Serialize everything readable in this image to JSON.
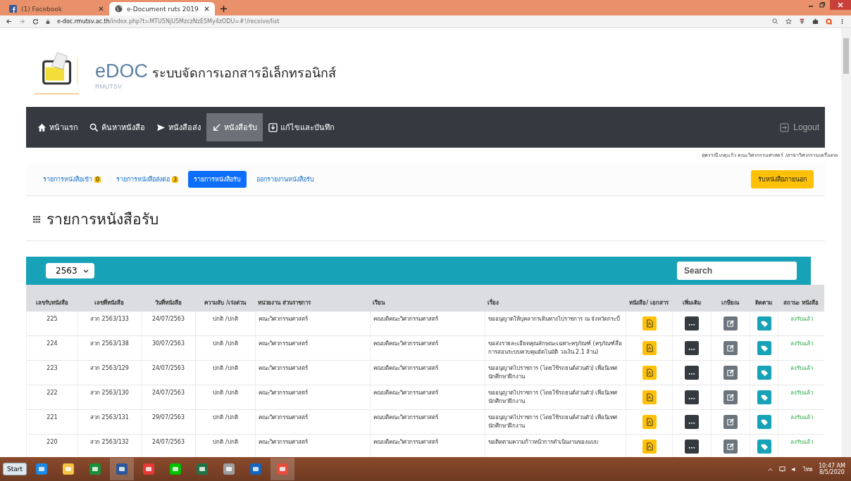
{
  "browser": {
    "tabs": [
      {
        "title": "(1) Facebook",
        "kind": "facebook",
        "selected": false
      },
      {
        "title": "e-Document ruts 2019",
        "kind": "globe",
        "selected": true
      }
    ],
    "url_host": "e-doc.rmutsv.ac.th",
    "url_path": "/index.php?t=MTU5NjU5MzczNzE5My4zODU=#!/receive/list"
  },
  "header": {
    "logo": "eDOC",
    "logo_sub": "RMUTSV",
    "system_name": "ระบบจัดการเอกสารอิเล็กทรอนิกส์"
  },
  "nav": {
    "items": [
      {
        "label": "หน้าแรก",
        "kind": "home",
        "selected": false
      },
      {
        "label": "ค้นหาหนังสือ",
        "kind": "search",
        "selected": false
      },
      {
        "label": "หนังสือส่ง",
        "kind": "send",
        "selected": false
      },
      {
        "label": "หนังสือรับ",
        "kind": "receive",
        "selected": true
      },
      {
        "label": "แก้ไขและบันทึก",
        "kind": "save",
        "selected": false
      }
    ],
    "logout": "Logout"
  },
  "user_line": "สุพรรณี เกตุแก้ว  คณะวิศวกรรมศาสตร์ /สาขาวิศวกรรมเครื่องกล",
  "subnav": {
    "items": [
      {
        "label": "รายการหนังสือเข้า",
        "badge": "0",
        "selected": false
      },
      {
        "label": "รายการหนังสือส่งต่อ",
        "badge": "3",
        "selected": false
      },
      {
        "label": "รายการหนังสือรับ",
        "selected": true
      },
      {
        "label": "ออกรายงานหนังสือรับ",
        "selected": false
      }
    ],
    "external_button": "รับหนังสือภายนอก"
  },
  "heading": "รายการหนังสือรับ",
  "table": {
    "year": "2563",
    "search_placeholder": "Search",
    "columns": [
      "เลขรับหนังสือ",
      "เลขที่หนังสือ",
      "วันที่หนังสือ",
      "ความลับ /เร่งด่วน",
      "หน่วยงาน ส่วนราชการ",
      "เรียน",
      "เรื่อง",
      "หนังสือ/ เอกสาร",
      "เพิ่มเติม",
      "เกษียณ",
      "ติดตาม",
      "สถานะ หนังสือ"
    ],
    "rows": [
      {
        "number": "225",
        "doc_no": "สวก 2563/133",
        "date": "24/07/2563",
        "priority": "ปกติ /ปกติ",
        "from": "คณะวิศวกรรมศาสตร์",
        "to": "คณบดีคณะวิศวกรรมศาสตร์",
        "subject": "ขออนุญาตให้บุคลากรเดินทางไปราชการ ณ จังหวัดกระบี่",
        "status": "ลงรับแล้ว"
      },
      {
        "number": "224",
        "doc_no": "สวก 2563/138",
        "date": "30/07/2563",
        "priority": "ปกติ /ปกติ",
        "from": "คณะวิศวกรรมศาสตร์",
        "to": "คณบดีคณะวิศวกรรมศาสตร์",
        "subject": "ขอส่งรายละเอียดคุณลักษณะเฉพาะครุภัณฑ์ (ครุภัณฑ์สื่อการสอนระบบควบคุมอัตโนมัติ วงเงิน 2.1 ล้าน)",
        "status": "ลงรับแล้ว"
      },
      {
        "number": "223",
        "doc_no": "สวก 2563/129",
        "date": "24/07/2563",
        "priority": "ปกติ /ปกติ",
        "from": "คณะวิศวกรรมศาสตร์",
        "to": "คณบดีคณะวิศวกรรมศาสตร์",
        "subject": "ขออนุญาตไปราชการ (โดยใช้รถยนต์ส่วนตัว) เพื่อนิเทศนักศึกษาฝึกงาน",
        "status": "ลงรับแล้ว"
      },
      {
        "number": "222",
        "doc_no": "สวก 2563/130",
        "date": "24/07/2563",
        "priority": "ปกติ /ปกติ",
        "from": "คณะวิศวกรรมศาสตร์",
        "to": "คณบดีคณะวิศวกรรมศาสตร์",
        "subject": "ขออนุญาตไปราชการ (โดยใช้รถยนต์ส่วนตัว) เพื่อนิเทศนักศึกษาฝึกงาน",
        "status": "ลงรับแล้ว"
      },
      {
        "number": "221",
        "doc_no": "สวก 2563/131",
        "date": "29/07/2563",
        "priority": "ปกติ /ปกติ",
        "from": "คณะวิศวกรรมศาสตร์",
        "to": "คณบดีคณะวิศวกรรมศาสตร์",
        "subject": "ขออนุญาตไปราชการ (โดยใช้รถยนต์ส่วนตัว) เพื่อนิเทศนักศึกษาฝึกงาน",
        "status": "ลงรับแล้ว"
      },
      {
        "number": "220",
        "doc_no": "สวก 2563/132",
        "date": "24/07/2563",
        "priority": "ปกติ /ปกติ",
        "from": "คณะวิศวกรรมศาสตร์",
        "to": "คณบดีคณะวิศวกรรมศาสตร์",
        "subject": "ขอติดตามความก้าวหน้าการดำเนินงานของแบบ",
        "status": "ลงรับแล้ว"
      }
    ]
  },
  "taskbar": {
    "start": "Start",
    "apps": [
      {
        "kind": "ie",
        "selected": false
      },
      {
        "kind": "folder",
        "selected": false
      },
      {
        "kind": "store",
        "selected": false
      },
      {
        "kind": "word",
        "selected": true
      },
      {
        "kind": "pdf",
        "selected": false
      },
      {
        "kind": "line",
        "selected": false
      },
      {
        "kind": "excel",
        "selected": false
      },
      {
        "kind": "tool",
        "selected": false
      },
      {
        "kind": "edge",
        "selected": false
      },
      {
        "kind": "chrome",
        "selected": true
      }
    ],
    "language": "ไทย",
    "time": "10:47 AM",
    "date": "8/5/2020"
  }
}
